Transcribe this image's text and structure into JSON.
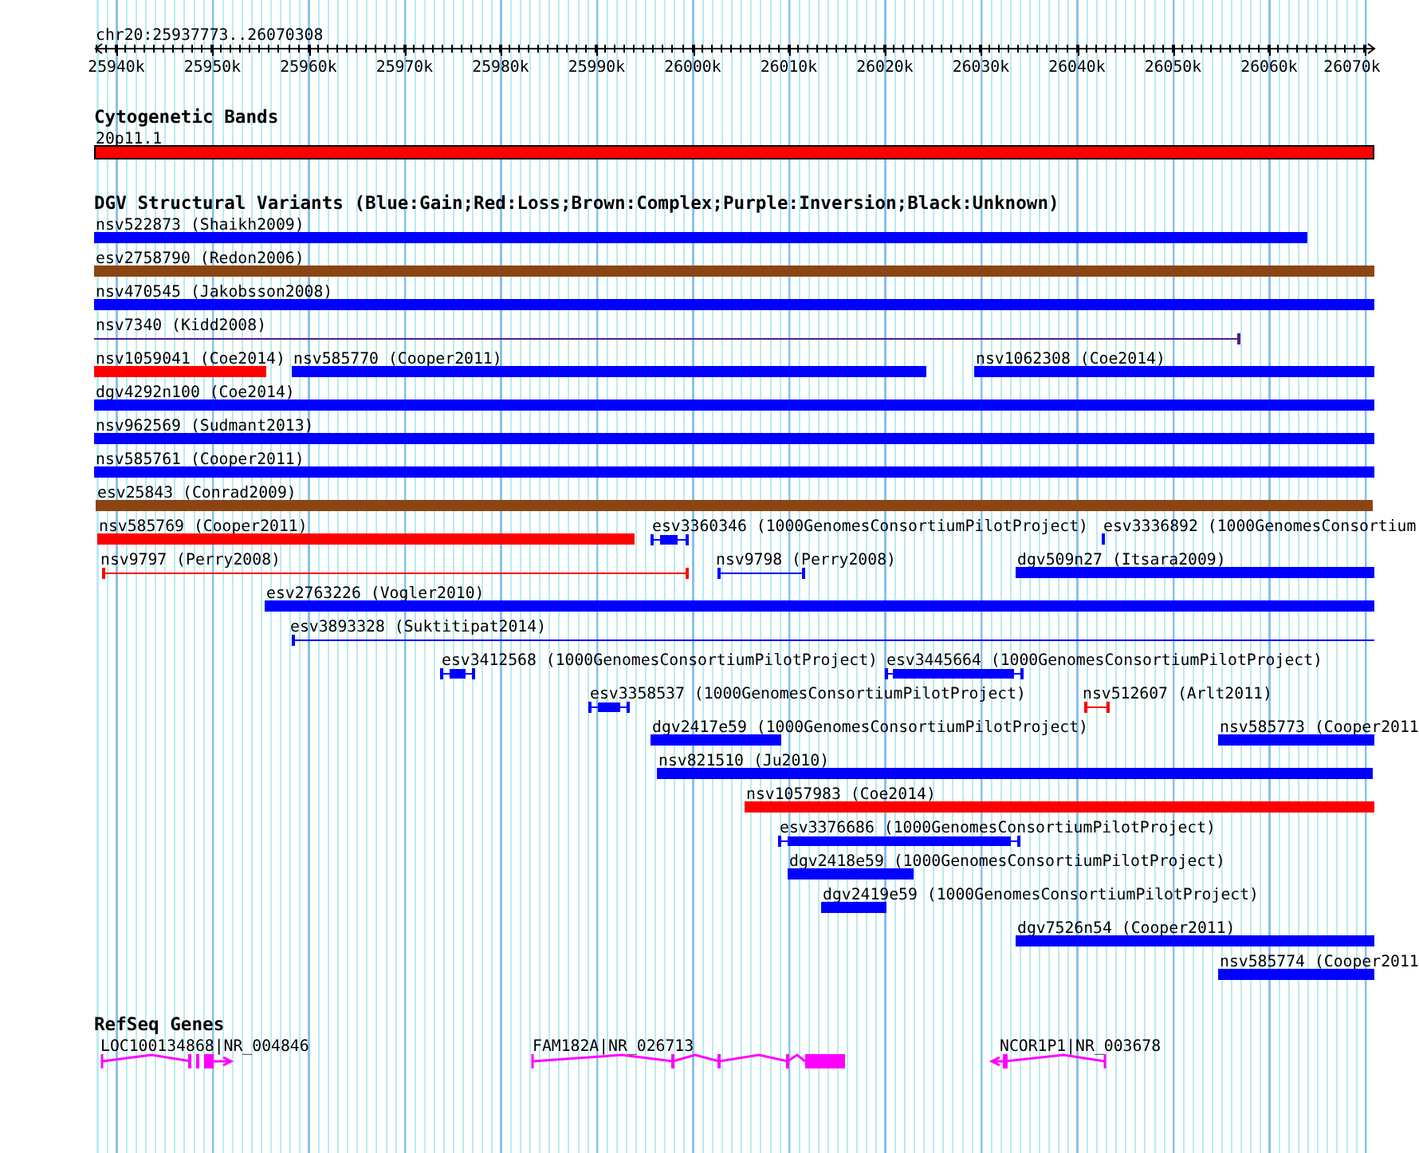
{
  "ruler": {
    "range": "chr20:25937773..26070308",
    "ticks": [
      "25940k",
      "25950k",
      "25960k",
      "25970k",
      "25980k",
      "25990k",
      "26000k",
      "26010k",
      "26020k",
      "26030k",
      "26040k",
      "26050k",
      "26060k",
      "26070k"
    ]
  },
  "tracks": [
    {
      "title": "Cytogenetic Bands",
      "features": [
        {
          "label": "20p11.1",
          "kind": "band",
          "color": "#ff0000"
        }
      ]
    },
    {
      "title": "DGV Structural Variants (Blue:Gain;Red:Loss;Brown:Complex;Purple:Inversion;Black:Unknown)",
      "features": [
        {
          "label": "nsv522873 (Shaikh2009)",
          "kind": "bar",
          "color": "#0000ff"
        },
        {
          "label": "esv2758790 (Redon2006)",
          "kind": "bar",
          "color": "#8b4513"
        },
        {
          "label": "nsv470545 (Jakobsson2008)",
          "kind": "bar",
          "color": "#0000ff"
        },
        {
          "label": "nsv7340 (Kidd2008)",
          "kind": "span",
          "color": "#551a8b"
        },
        {
          "label": "nsv1059041 (Coe2014)",
          "kind": "bar",
          "color": "#ff0000"
        },
        {
          "label": "nsv585770 (Cooper2011)",
          "kind": "bar",
          "color": "#0000ff"
        },
        {
          "label": "nsv1062308 (Coe2014)",
          "kind": "bar",
          "color": "#0000ff"
        },
        {
          "label": "dgv4292n100 (Coe2014)",
          "kind": "bar",
          "color": "#0000ff"
        },
        {
          "label": "nsv962569 (Sudmant2013)",
          "kind": "bar",
          "color": "#0000ff"
        },
        {
          "label": "nsv585761 (Cooper2011)",
          "kind": "bar",
          "color": "#0000ff"
        },
        {
          "label": "esv25843 (Conrad2009)",
          "kind": "bar",
          "color": "#8b4513"
        },
        {
          "label": "nsv585769 (Cooper2011)",
          "kind": "bar",
          "color": "#ff0000"
        },
        {
          "label": "esv3360346 (1000GenomesConsortiumPilotProject)",
          "kind": "capped",
          "color": "#0000ff"
        },
        {
          "label": "esv3336892 (1000GenomesConsortium",
          "kind": "bar",
          "color": "#0000ff"
        },
        {
          "label": "nsv9797 (Perry2008)",
          "kind": "span",
          "color": "#ff0000"
        },
        {
          "label": "nsv9798 (Perry2008)",
          "kind": "span",
          "color": "#0000ff"
        },
        {
          "label": "dgv509n27 (Itsara2009)",
          "kind": "bar",
          "color": "#0000ff"
        },
        {
          "label": "esv2763226 (Vogler2010)",
          "kind": "bar",
          "color": "#0000ff"
        },
        {
          "label": "esv3893328 (Suktitipat2014)",
          "kind": "span",
          "color": "#0000ff"
        },
        {
          "label": "esv3412568 (1000GenomesConsortiumPilotProject)",
          "kind": "capped",
          "color": "#0000ff"
        },
        {
          "label": "esv3445664 (1000GenomesConsortiumPilotProject)",
          "kind": "capped",
          "color": "#0000ff"
        },
        {
          "label": "esv3358537 (1000GenomesConsortiumPilotProject)",
          "kind": "capped",
          "color": "#0000ff"
        },
        {
          "label": "nsv512607 (Arlt2011)",
          "kind": "span",
          "color": "#ff0000"
        },
        {
          "label": "dgv2417e59 (1000GenomesConsortiumPilotProject)",
          "kind": "bar",
          "color": "#0000ff"
        },
        {
          "label": "nsv585773 (Cooper2011",
          "kind": "bar",
          "color": "#0000ff"
        },
        {
          "label": "nsv821510 (Ju2010)",
          "kind": "bar",
          "color": "#0000ff"
        },
        {
          "label": "nsv1057983 (Coe2014)",
          "kind": "bar",
          "color": "#ff0000"
        },
        {
          "label": "esv3376686 (1000GenomesConsortiumPilotProject)",
          "kind": "capped",
          "color": "#0000ff"
        },
        {
          "label": "dgv2418e59 (1000GenomesConsortiumPilotProject)",
          "kind": "bar",
          "color": "#0000ff"
        },
        {
          "label": "dgv2419e59 (1000GenomesConsortiumPilotProject)",
          "kind": "bar",
          "color": "#0000ff"
        },
        {
          "label": "dgv7526n54 (Cooper2011)",
          "kind": "bar",
          "color": "#0000ff"
        },
        {
          "label": "nsv585774 (Cooper2011",
          "kind": "bar",
          "color": "#0000ff"
        }
      ]
    },
    {
      "title": "RefSeq Genes",
      "features": [
        {
          "label": "LOC100134868|NR_004846",
          "kind": "gene",
          "color": "#ff00ff"
        },
        {
          "label": "FAM182A|NR_026713",
          "kind": "gene",
          "color": "#ff00ff"
        },
        {
          "label": "NCOR1P1|NR_003678",
          "kind": "gene",
          "color": "#ff00ff"
        }
      ]
    }
  ]
}
